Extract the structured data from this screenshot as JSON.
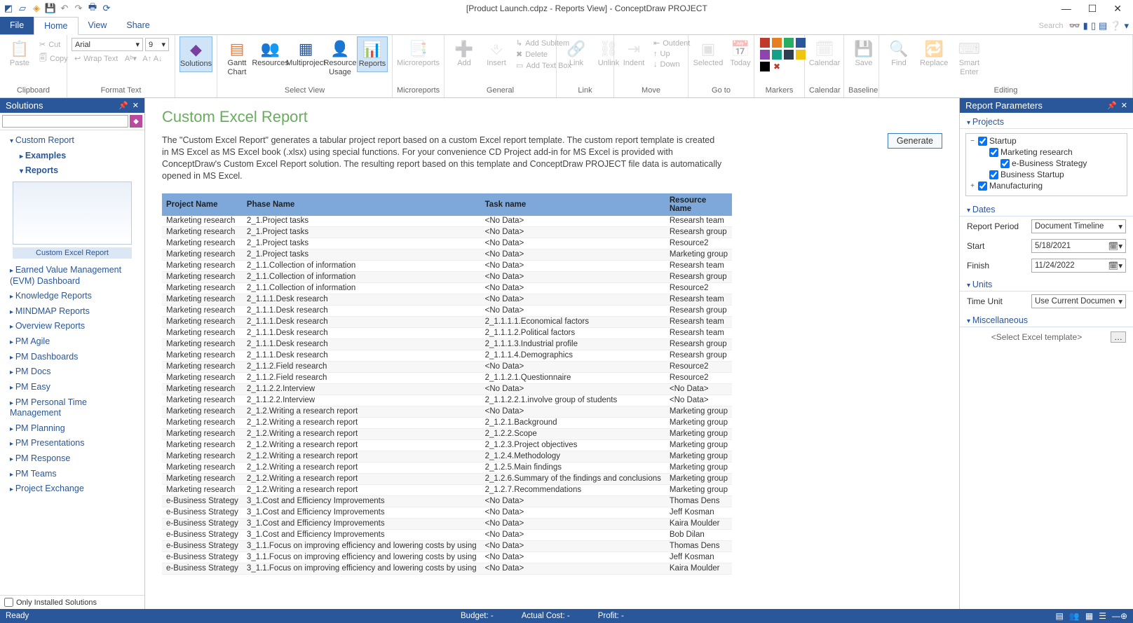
{
  "window_title": "[Product Launch.cdpz - Reports View] - ConceptDraw PROJECT",
  "tabs": {
    "file": "File",
    "home": "Home",
    "view": "View",
    "share": "Share"
  },
  "ribbon": {
    "clipboard": {
      "paste": "Paste",
      "cut": "Cut",
      "copy": "Copy",
      "label": "Clipboard"
    },
    "format": {
      "font": "Arial",
      "size": "9",
      "wrap": "Wrap Text",
      "label": "Format Text"
    },
    "solutions": {
      "btn": "Solutions"
    },
    "selectview": {
      "gantt": "Gantt\nChart",
      "resources": "Resources",
      "multiproject": "Multiproject",
      "rusage": "Resource\nUsage",
      "reports": "Reports",
      "label": "Select View"
    },
    "microreports": {
      "btn": "Microreports",
      "label": "Microreports"
    },
    "general": {
      "add": "Add",
      "insert": "Insert",
      "subitem": "Add Subitem",
      "delete": "Delete",
      "textbox": "Add Text Box",
      "label": "General"
    },
    "link": {
      "link": "Link",
      "unlink": "Unlink",
      "label": "Link"
    },
    "move": {
      "indent": "Indent",
      "outdent": "Outdent",
      "up": "Up",
      "down": "Down",
      "label": "Move"
    },
    "goto": {
      "selected": "Selected",
      "today": "Today",
      "label": "Go to"
    },
    "markers": {
      "label": "Markers"
    },
    "calendar": {
      "calendar": "Calendar",
      "label": "Calendar"
    },
    "baseline": {
      "save": "Save",
      "label": "Baseline"
    },
    "editing": {
      "find": "Find",
      "replace": "Replace",
      "smart": "Smart\nEnter",
      "label": "Editing"
    }
  },
  "left_panel": {
    "title": "Solutions",
    "root": "Custom Report",
    "examples": "Examples",
    "reports": "Reports",
    "thumb_caption": "Custom Excel Report",
    "cats": [
      "Earned Value Management (EVM) Dashboard",
      "Knowledge Reports",
      "MINDMAP Reports",
      "Overview Reports",
      "PM Agile",
      "PM Dashboards",
      "PM Docs",
      "PM Easy",
      "PM Personal Time Management",
      "PM Planning",
      "PM Presentations",
      "PM Response",
      "PM Teams",
      "Project Exchange"
    ],
    "only_installed": "Only Installed Solutions"
  },
  "center": {
    "title": "Custom Excel Report",
    "desc": "The \"Custom Excel Report\" generates a tabular project report based on a custom Excel report template. The custom report template is created in MS Excel as MS Excel book (.xlsx) using special functions. For your convenience CD Project add-in for MS Excel is provided with ConceptDraw's Custom Excel Report solution. The resulting report based on this template and ConceptDraw PROJECT file data is automatically opened in MS Excel.",
    "generate": "Generate",
    "cols": [
      "Project Name",
      "Phase Name",
      "Task name",
      "Resource Name"
    ],
    "rows": [
      [
        "Marketing research",
        "2_1.Project tasks",
        "<No Data>",
        "Researsh team"
      ],
      [
        "Marketing research",
        "2_1.Project tasks",
        "<No Data>",
        "Researsh group"
      ],
      [
        "Marketing research",
        "2_1.Project tasks",
        "<No Data>",
        "Resource2"
      ],
      [
        "Marketing research",
        "2_1.Project tasks",
        "<No Data>",
        "Marketing group"
      ],
      [
        "Marketing research",
        "2_1.1.Collection of information",
        "<No Data>",
        "Researsh team"
      ],
      [
        "Marketing research",
        "2_1.1.Collection of information",
        "<No Data>",
        "Researsh group"
      ],
      [
        "Marketing research",
        "2_1.1.Collection of information",
        "<No Data>",
        "Resource2"
      ],
      [
        "Marketing research",
        "2_1.1.1.Desk research",
        "<No Data>",
        "Researsh team"
      ],
      [
        "Marketing research",
        "2_1.1.1.Desk research",
        "<No Data>",
        "Researsh group"
      ],
      [
        "Marketing research",
        "2_1.1.1.Desk research",
        "2_1.1.1.1.Economical factors",
        "Researsh team"
      ],
      [
        "Marketing research",
        "2_1.1.1.Desk research",
        "2_1.1.1.2.Political factors",
        "Researsh team"
      ],
      [
        "Marketing research",
        "2_1.1.1.Desk research",
        "2_1.1.1.3.Industrial profile",
        "Researsh group"
      ],
      [
        "Marketing research",
        "2_1.1.1.Desk research",
        "2_1.1.1.4.Demographics",
        "Researsh group"
      ],
      [
        "Marketing research",
        "2_1.1.2.Field research",
        "<No Data>",
        "Resource2"
      ],
      [
        "Marketing research",
        "2_1.1.2.Field research",
        "2_1.1.2.1.Questionnaire",
        "Resource2"
      ],
      [
        "Marketing research",
        "2_1.1.2.2.Interview",
        "<No Data>",
        "<No Data>"
      ],
      [
        "Marketing research",
        "2_1.1.2.2.Interview",
        "2_1.1.2.2.1.involve group of  students",
        "<No Data>"
      ],
      [
        "Marketing research",
        "2_1.2.Writing a research report",
        "<No Data>",
        "Marketing group"
      ],
      [
        "Marketing research",
        "2_1.2.Writing a research report",
        "2_1.2.1.Background",
        "Marketing group"
      ],
      [
        "Marketing research",
        "2_1.2.Writing a research report",
        "2_1.2.2.Scope",
        "Marketing group"
      ],
      [
        "Marketing research",
        "2_1.2.Writing a research report",
        "2_1.2.3.Project objectives",
        "Marketing group"
      ],
      [
        "Marketing research",
        "2_1.2.Writing a research report",
        "2_1.2.4.Methodology",
        "Marketing group"
      ],
      [
        "Marketing research",
        "2_1.2.Writing a research report",
        "2_1.2.5.Main findings",
        "Marketing group"
      ],
      [
        "Marketing research",
        "2_1.2.Writing a research report",
        "2_1.2.6.Summary of the findings and conclusions",
        "Marketing group"
      ],
      [
        "Marketing research",
        "2_1.2.Writing a research report",
        "2_1.2.7.Recommendations",
        "Marketing group"
      ],
      [
        "e-Business Strategy",
        "3_1.Cost and Efficiency Improvements",
        "<No Data>",
        "Thomas Dens"
      ],
      [
        "e-Business Strategy",
        "3_1.Cost and Efficiency Improvements",
        "<No Data>",
        "Jeff Kosman"
      ],
      [
        "e-Business Strategy",
        "3_1.Cost and Efficiency Improvements",
        "<No Data>",
        "Kaira Moulder"
      ],
      [
        "e-Business Strategy",
        "3_1.Cost and Efficiency Improvements",
        "<No Data>",
        "Bob Dilan"
      ],
      [
        "e-Business Strategy",
        "3_1.1.Focus on improving efficiency and lowering costs by using",
        "<No Data>",
        "Thomas Dens"
      ],
      [
        "e-Business Strategy",
        "3_1.1.Focus on improving efficiency and lowering costs by using",
        "<No Data>",
        "Jeff Kosman"
      ],
      [
        "e-Business Strategy",
        "3_1.1.Focus on improving efficiency and lowering costs by using",
        "<No Data>",
        "Kaira Moulder"
      ]
    ]
  },
  "right_panel": {
    "title": "Report Parameters",
    "sec_projects": "Projects",
    "projects": [
      {
        "name": "Startup",
        "lvl": 0,
        "exp": "−"
      },
      {
        "name": "Marketing research",
        "lvl": 1
      },
      {
        "name": "e-Business Strategy",
        "lvl": 2
      },
      {
        "name": "Business Startup",
        "lvl": 1
      },
      {
        "name": "Manufacturing",
        "lvl": 0,
        "exp": "+"
      }
    ],
    "sec_dates": "Dates",
    "report_period_lbl": "Report Period",
    "report_period_val": "Document Timeline",
    "start_lbl": "Start",
    "start_val": "5/18/2021",
    "finish_lbl": "Finish",
    "finish_val": "11/24/2022",
    "sec_units": "Units",
    "time_unit_lbl": "Time Unit",
    "time_unit_val": "Use Current Documen",
    "sec_misc": "Miscellaneous",
    "template_sel": "<Select Excel template>"
  },
  "status": {
    "ready": "Ready",
    "budget": "Budget: -",
    "actual": "Actual Cost: -",
    "profit": "Profit: -"
  },
  "search_placeholder": "Search"
}
